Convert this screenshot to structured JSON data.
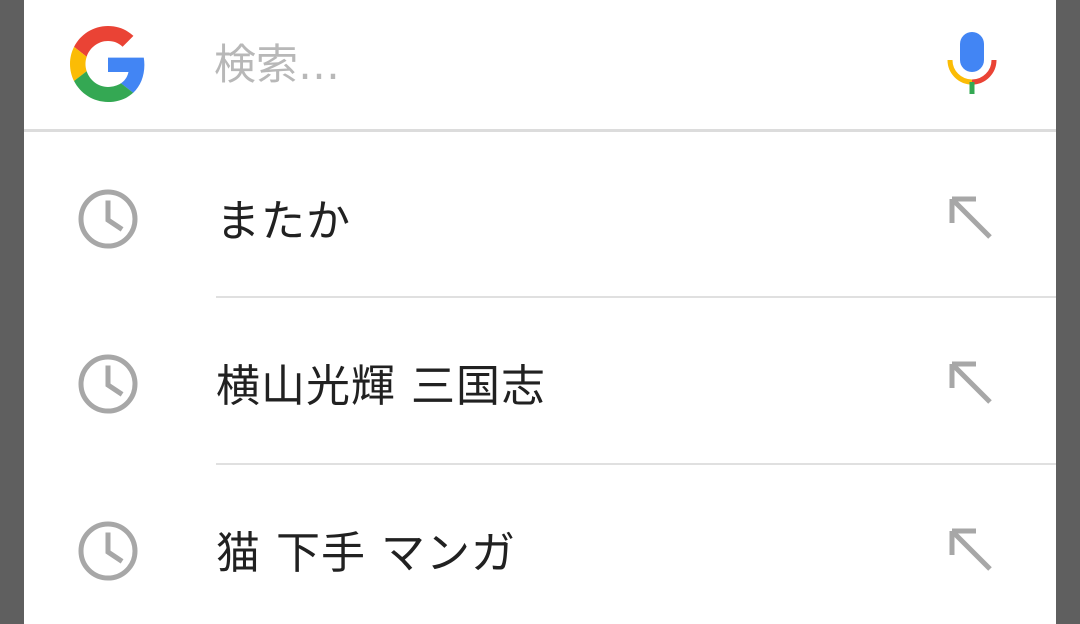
{
  "search": {
    "placeholder": "検索…",
    "value": ""
  },
  "icons": {
    "logo": "google-g-icon",
    "voice": "microphone-icon",
    "history": "clock-icon",
    "fill": "arrow-up-left-icon"
  },
  "colors": {
    "google_blue": "#4285F4",
    "google_red": "#EA4335",
    "google_yellow": "#FBBC05",
    "google_green": "#34A853",
    "icon_gray": "#a7a7a7",
    "text": "#212121",
    "placeholder": "#b8b8b8"
  },
  "suggestions": [
    {
      "text": "またか"
    },
    {
      "text": "横山光輝 三国志"
    },
    {
      "text": "猫 下手 マンガ"
    }
  ]
}
